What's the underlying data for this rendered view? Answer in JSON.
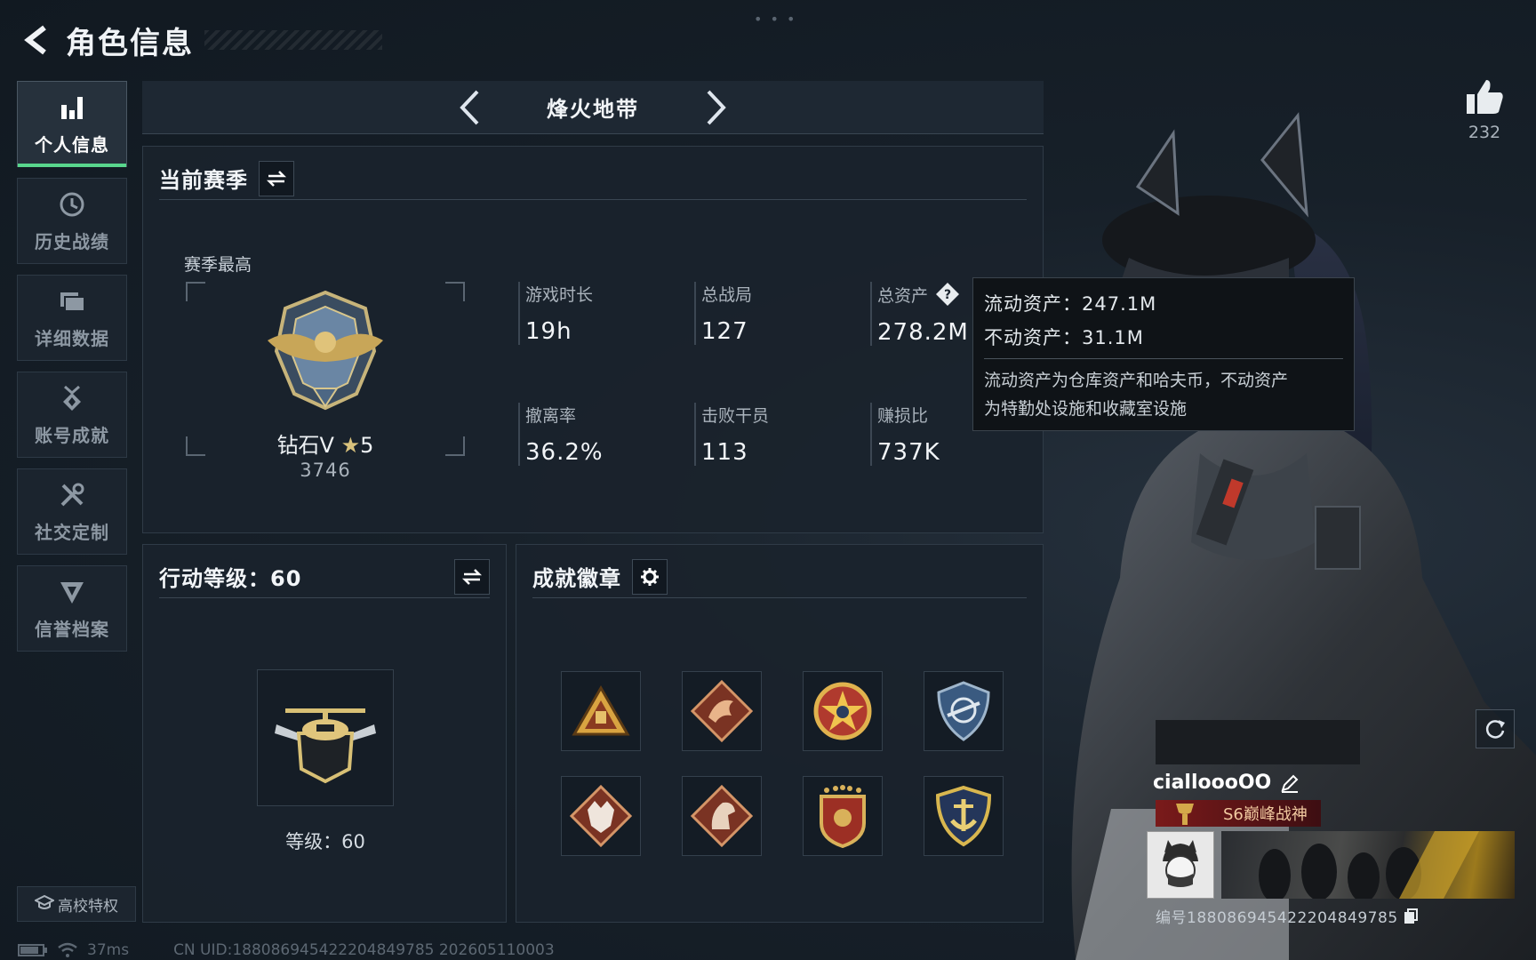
{
  "header": {
    "title": "角色信息"
  },
  "sidebar": {
    "items": [
      {
        "label": "个人信息",
        "icon": "bar-chart-icon",
        "active": true
      },
      {
        "label": "历史战绩",
        "icon": "history-clock-icon",
        "active": false
      },
      {
        "label": "详细数据",
        "icon": "folder-icon",
        "active": false
      },
      {
        "label": "账号成就",
        "icon": "medal-icon",
        "active": false
      },
      {
        "label": "社交定制",
        "icon": "tools-icon",
        "active": false
      },
      {
        "label": "信誉档案",
        "icon": "credit-shield-icon",
        "active": false
      }
    ],
    "campus_label": "高校特权"
  },
  "mode_nav": {
    "title": "烽火地带"
  },
  "season": {
    "title": "当前赛季",
    "best_label": "赛季最高",
    "rank_name": "钻石V",
    "rank_stars": "5",
    "rank_score": "3746",
    "stats": [
      {
        "label": "游戏时长",
        "value": "19h"
      },
      {
        "label": "总战局",
        "value": "127"
      },
      {
        "label": "总资产",
        "value": "278.2M"
      },
      {
        "label": "撤离率",
        "value": "36.2%"
      },
      {
        "label": "击败干员",
        "value": "113"
      },
      {
        "label": "赚损比",
        "value": "737K"
      }
    ]
  },
  "tooltip": {
    "liquid": "流动资产：247.1M",
    "fixed": "不动资产：31.1M",
    "desc_line1": "流动资产为仓库资产和哈夫币，不动资产",
    "desc_line2": "为特勤处设施和收藏室设施"
  },
  "action_level": {
    "title": "行动等级：60",
    "level_label": "等级：60"
  },
  "badges": {
    "title": "成就徽章",
    "items": [
      "triangle-badge",
      "dragon-badge",
      "star-badge",
      "shield-badge",
      "wolf-badge",
      "horse-badge",
      "crest-badge",
      "anchor-badge"
    ]
  },
  "character": {
    "likes": "232",
    "name": "cialloooOO",
    "title_badge": "S6巅峰战神",
    "player_id": "编号1880869454222048497​85"
  },
  "footer": {
    "ping": "37ms",
    "uid": "CN UID:18808694542220484978​5 202605110003"
  },
  "colors": {
    "accent_green": "#58d68d",
    "background": "#121a23",
    "panel": "#1a232d"
  }
}
